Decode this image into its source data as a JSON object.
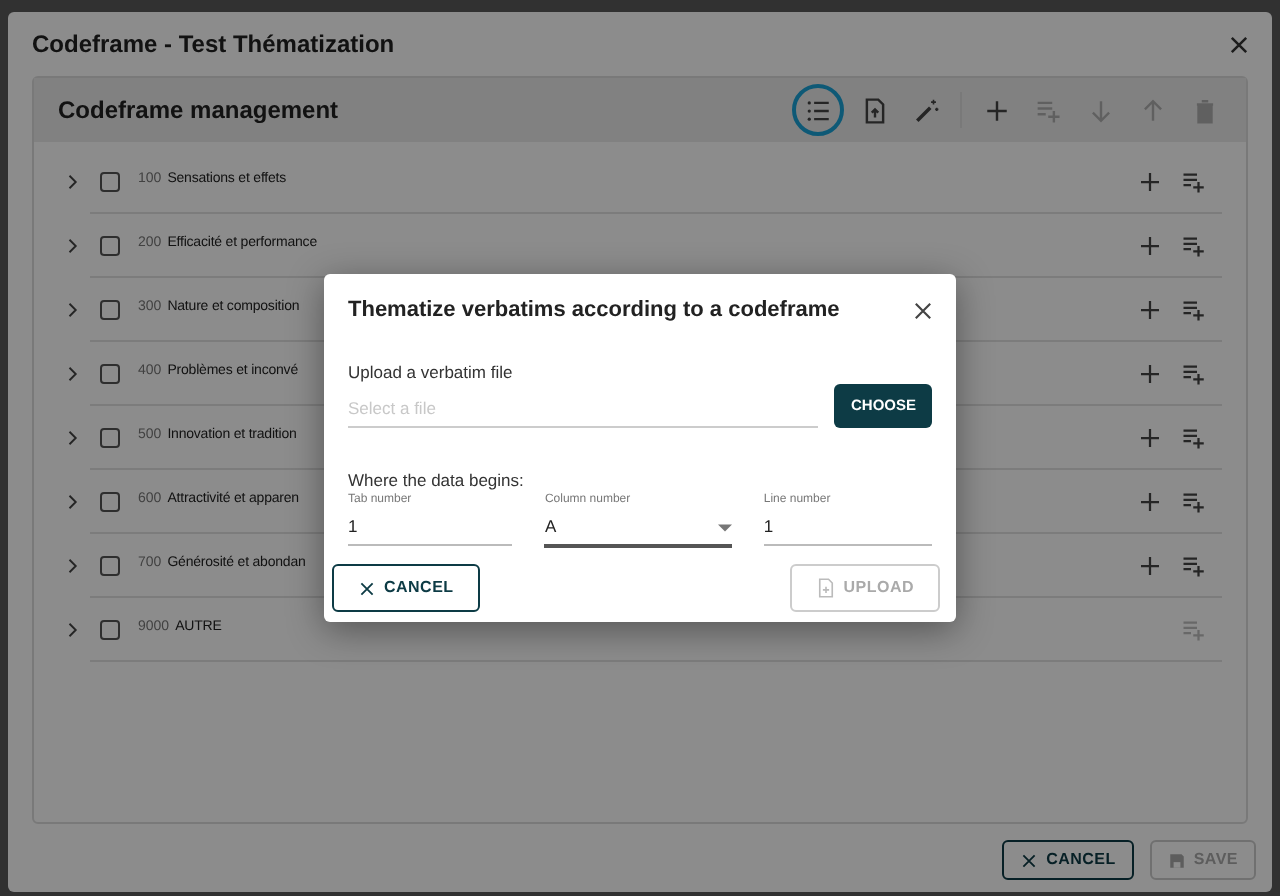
{
  "window": {
    "title": "Codeframe - Test Thématization"
  },
  "panel": {
    "title": "Codeframe management",
    "toolbar": [
      {
        "kind": "list",
        "highlighted": true,
        "disabled": false
      },
      {
        "kind": "file-upload",
        "highlighted": false,
        "disabled": false
      },
      {
        "kind": "wand",
        "highlighted": false,
        "disabled": false
      },
      {
        "kind": "plus",
        "highlighted": false,
        "disabled": false
      },
      {
        "kind": "list-add",
        "highlighted": false,
        "disabled": true
      },
      {
        "kind": "arrow-down",
        "highlighted": false,
        "disabled": true
      },
      {
        "kind": "arrow-up",
        "highlighted": false,
        "disabled": true
      },
      {
        "kind": "trash",
        "highlighted": false,
        "disabled": true
      }
    ],
    "rows": [
      {
        "code": "100",
        "label": "Sensations et effets",
        "checked": false,
        "disabled": false
      },
      {
        "code": "200",
        "label": "Efficacité et performance",
        "checked": false,
        "disabled": false
      },
      {
        "code": "300",
        "label": "Nature et composition",
        "checked": false,
        "disabled": false
      },
      {
        "code": "400",
        "label": "Problèmes et inconvé",
        "checked": false,
        "disabled": false
      },
      {
        "code": "500",
        "label": "Innovation et tradition",
        "checked": false,
        "disabled": false
      },
      {
        "code": "600",
        "label": "Attractivité et apparen",
        "checked": false,
        "disabled": false
      },
      {
        "code": "700",
        "label": "Générosité et abondan",
        "checked": false,
        "disabled": false
      },
      {
        "code": "9000",
        "label": "AUTRE",
        "checked": false,
        "disabled": true
      }
    ]
  },
  "footer": {
    "cancel": "CANCEL",
    "save": "SAVE",
    "save_disabled": true
  },
  "dialog": {
    "title": "Thematize verbatims according to a codeframe",
    "upload_label": "Upload a verbatim file",
    "file_placeholder": "Select a file",
    "choose": "CHOOSE",
    "section_label": "Where the data begins:",
    "fields": [
      {
        "kind": "text",
        "label": "Tab number",
        "value": "1"
      },
      {
        "kind": "select",
        "label": "Column number",
        "value": "A"
      },
      {
        "kind": "text",
        "label": "Line number",
        "value": "1"
      }
    ],
    "cancel": "CANCEL",
    "upload": "UPLOAD",
    "upload_disabled": true
  }
}
